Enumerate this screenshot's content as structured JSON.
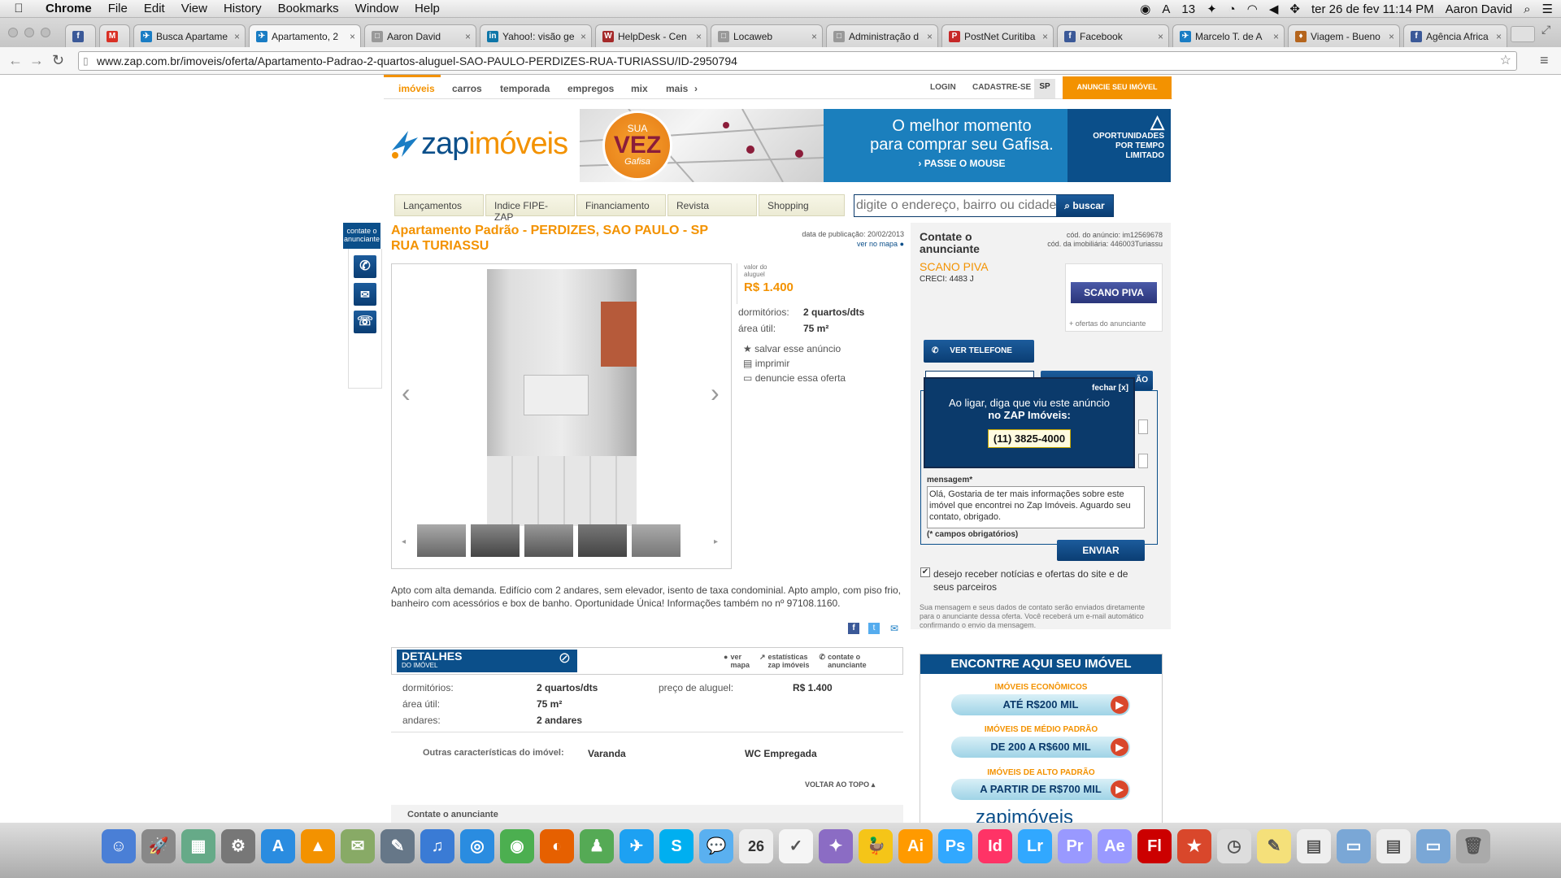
{
  "menubar": {
    "app": "Chrome",
    "items": [
      "File",
      "Edit",
      "View",
      "History",
      "Bookmarks",
      "Window",
      "Help"
    ],
    "status_count": "13",
    "clock": "ter 26 de fev  11:14 PM",
    "user": "Aaron David"
  },
  "tabs": [
    {
      "label": "",
      "fav": "f",
      "color": "#3b5998"
    },
    {
      "label": "",
      "fav": "M",
      "color": "#d93025"
    },
    {
      "label": "Busca Apartame",
      "fav": "✈",
      "color": "#1a7dc4"
    },
    {
      "label": "Apartamento, 2",
      "fav": "✈",
      "color": "#1a7dc4",
      "active": true
    },
    {
      "label": "Aaron David",
      "fav": "□",
      "color": "#999"
    },
    {
      "label": "Yahoo!: visão ge",
      "fav": "in",
      "color": "#0e76a8"
    },
    {
      "label": "HelpDesk - Cen",
      "fav": "W",
      "color": "#a52a2a"
    },
    {
      "label": "Locaweb",
      "fav": "□",
      "color": "#999"
    },
    {
      "label": "Administração d",
      "fav": "□",
      "color": "#999"
    },
    {
      "label": "PostNet Curitiba",
      "fav": "P",
      "color": "#c62828"
    },
    {
      "label": "Facebook",
      "fav": "f",
      "color": "#3b5998"
    },
    {
      "label": "Marcelo T. de A",
      "fav": "✈",
      "color": "#1a7dc4"
    },
    {
      "label": "Viagem - Bueno",
      "fav": "♦",
      "color": "#b5651d"
    },
    {
      "label": "Agência Africa",
      "fav": "f",
      "color": "#3b5998"
    }
  ],
  "url": "www.zap.com.br/imoveis/oferta/Apartamento-Padrao-2-quartos-aluguel-SAO-PAULO-PERDIZES-RUA-TURIASSU/ID-2950794",
  "topnav": {
    "left": [
      "imóveis",
      "carros",
      "temporada",
      "empregos",
      "mix",
      "mais"
    ],
    "login": "LOGIN",
    "signup": "CADASTRE-SE",
    "region": "SP",
    "advertise": "ANUNCIE SEU IMÓVEL"
  },
  "logo": {
    "zap": "zap",
    "imoveis": "imóveis"
  },
  "banner": {
    "badge_top": "SUA",
    "badge_mid": "VEZ",
    "badge_bot": "Gafisa",
    "headline1": "O melhor momento",
    "headline2": "para comprar seu Gafisa.",
    "cta": "› PASSE O MOUSE",
    "side1": "OPORTUNIDADES",
    "side2": "POR TEMPO",
    "side3": "LIMITADO"
  },
  "subtabs": [
    "Lançamentos",
    "Indice FIPE-ZAP",
    "Financiamento",
    "Revista",
    "Shopping"
  ],
  "search": {
    "placeholder": "digite o endereço, bairro ou cidade",
    "button": "buscar"
  },
  "side_contact": {
    "label1": "contate o",
    "label2": "anunciante"
  },
  "listing": {
    "title1": "Apartamento Padrão - PERDIZES, SAO PAULO - SP",
    "title2": "RUA TURIASSU",
    "published": "data de publicação: 20/02/2013",
    "see_map": "ver no mapa",
    "rent_label1": "valor do",
    "rent_label2": "aluguel",
    "rent_value": "R$ 1.400",
    "bedrooms_label": "dormitórios:",
    "bedrooms_value": "2 quartos/dts",
    "area_label": "área útil:",
    "area_value": "75 m²",
    "save": "salvar esse anúncio",
    "print": "imprimir",
    "report": "denuncie essa oferta",
    "description": "Apto com alta demanda. Edifício com 2 andares, sem elevador, isento de taxa condominial. Apto amplo, com piso frio, banheiro com acessórios e box de banho. Oportunidade Única! Informações também no nº 97108.1160."
  },
  "details": {
    "header1": "DETALHES",
    "header2": "DO IMÓVEL",
    "link_map1": "ver",
    "link_map2": "mapa",
    "link_stats1": "estatísticas",
    "link_stats2": "zap imóveis",
    "link_contact1": "contate o",
    "link_contact2": "anunciante",
    "bedrooms_label": "dormitórios:",
    "bedrooms_value": "2 quartos/dts",
    "area_label": "área útil:",
    "area_value": "75 m²",
    "floors_label": "andares:",
    "floors_value": "2 andares",
    "rent_label": "preço de aluguel:",
    "rent_value": "R$ 1.400",
    "other_label": "Outras características do imóvel:",
    "other1": "Varanda",
    "other2": "WC Empregada",
    "back_top": "VOLTAR AO TOPO",
    "contact_footer": "Contate o anunciante"
  },
  "contact": {
    "title1": "Contate o",
    "title2": "anunciante",
    "ad_code": "cód. do anúncio: im12569678",
    "agency_code": "cód. da imobiliária: 446003Turiassu",
    "agency": "SCANO PIVA",
    "creci": "CRECI: 4483 J",
    "agency_logo": "SCANO PIVA",
    "more_offers": "+ ofertas do anunciante",
    "phone_button": "VER TELEFONE",
    "email_button": "ÃO",
    "popup_close": "fechar [x]",
    "popup_text1": "Ao ligar, diga que viu este anúncio",
    "popup_text2": "no ZAP Imóveis:",
    "popup_phone": "(11) 3825-4000",
    "message_label": "mensagem*",
    "message_value": "Olá, Gostaria de ter mais informações sobre este imóvel que encontrei no Zap Imóveis. Aguardo seu contato, obrigado.",
    "required": "(* campos obrigatórios)",
    "send": "ENVIAR",
    "newsletter": "desejo receber notícias e ofertas do site e de seus parceiros",
    "disclaimer": "Sua mensagem e seus dados de contato serão enviados diretamente para o anunciante dessa oferta. Você receberá um e-mail automático confirmando o envio da mensagem."
  },
  "find": {
    "header": "ENCONTRE AQUI SEU IMÓVEL",
    "cat1": "IMÓVEIS ECONÔMICOS",
    "btn1": "ATÉ R$200 MIL",
    "cat2": "IMÓVEIS DE MÉDIO PADRÃO",
    "btn2": "DE 200 A R$600 MIL",
    "cat3": "IMÓVEIS DE ALTO PADRÃO",
    "btn3": "A PARTIR DE R$700 MIL",
    "logo": "zapimóveis"
  },
  "dock": [
    "Finder",
    "Launchpad",
    "Preview",
    "System Preferences",
    "App Store",
    "VLC",
    "Mail Stamp",
    "Preview2",
    "iTunes",
    "Safari",
    "Chrome",
    "Firefox",
    "Network",
    "Twitter",
    "Skype",
    "Messages",
    "Calendar",
    "Reminders",
    "Script",
    "Cyberduck",
    "Illustrator",
    "Photoshop",
    "InDesign",
    "Lightroom",
    "Premiere",
    "After Effects",
    "Flash",
    "Stamp",
    "Time",
    "Stickies",
    "Documents",
    "Folder1",
    "Doc",
    "Folder2",
    "Trash"
  ],
  "dock_calendar_day": "26"
}
